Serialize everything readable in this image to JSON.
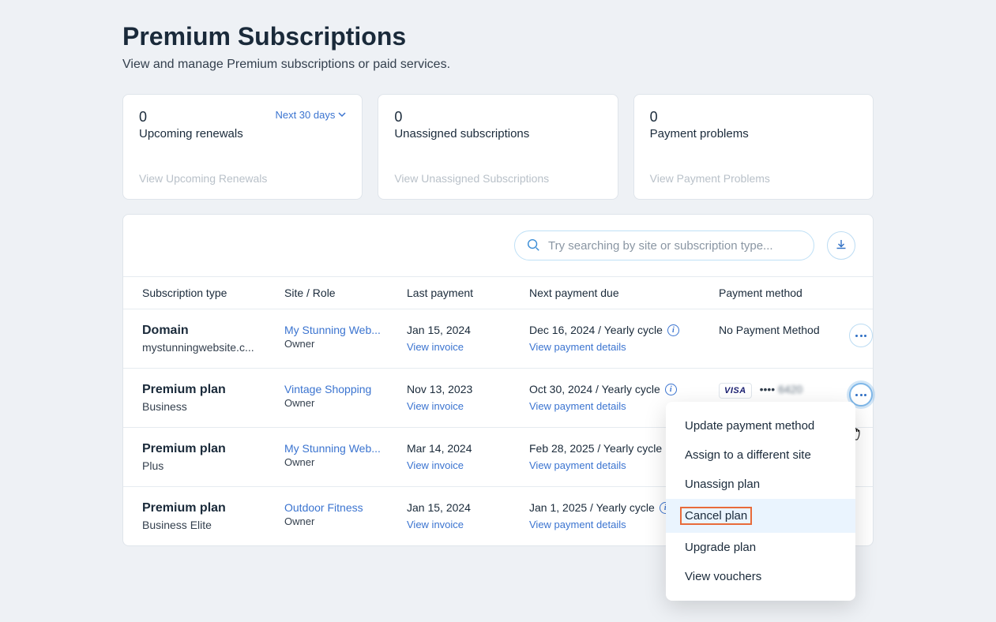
{
  "header": {
    "title": "Premium Subscriptions",
    "subtitle": "View and manage Premium subscriptions or paid services."
  },
  "cards": [
    {
      "count": "0",
      "label": "Upcoming renewals",
      "period": "Next 30 days",
      "link": "View Upcoming Renewals"
    },
    {
      "count": "0",
      "label": "Unassigned subscriptions",
      "link": "View Unassigned Subscriptions"
    },
    {
      "count": "0",
      "label": "Payment problems",
      "link": "View Payment Problems"
    }
  ],
  "search": {
    "placeholder": "Try searching by site or subscription type..."
  },
  "columns": {
    "sub": "Subscription type",
    "site": "Site / Role",
    "last": "Last payment",
    "next": "Next payment due",
    "method": "Payment method"
  },
  "labels": {
    "view_invoice": "View invoice",
    "view_payment_details": "View payment details"
  },
  "rows": [
    {
      "type": "Domain",
      "sub": "mystunningwebsite.c...",
      "site": "My Stunning Web...",
      "role": "Owner",
      "last": "Jan 15, 2024",
      "next": "Dec 16, 2024 / Yearly cycle",
      "method_text": "No Payment Method",
      "method_kind": "text"
    },
    {
      "type": "Premium plan",
      "sub": "Business",
      "site": "Vintage Shopping",
      "role": "Owner",
      "last": "Nov 13, 2023",
      "next": "Oct 30, 2024 / Yearly cycle",
      "method_kind": "card",
      "card_brand": "VISA",
      "card_dots": "••••",
      "card_last": "6420"
    },
    {
      "type": "Premium plan",
      "sub": "Plus",
      "site": "My Stunning Web...",
      "role": "Owner",
      "last": "Mar 14, 2024",
      "next": "Feb 28, 2025 / Yearly cycle",
      "method_kind": "none"
    },
    {
      "type": "Premium plan",
      "sub": "Business Elite",
      "site": "Outdoor Fitness",
      "role": "Owner",
      "last": "Jan 15, 2024",
      "next": "Jan 1, 2025 / Yearly cycle",
      "method_kind": "none"
    }
  ],
  "menu": {
    "items": [
      "Update payment method",
      "Assign to a different site",
      "Unassign plan",
      "Cancel plan",
      "Upgrade plan",
      "View vouchers"
    ],
    "highlighted_index": 3
  }
}
